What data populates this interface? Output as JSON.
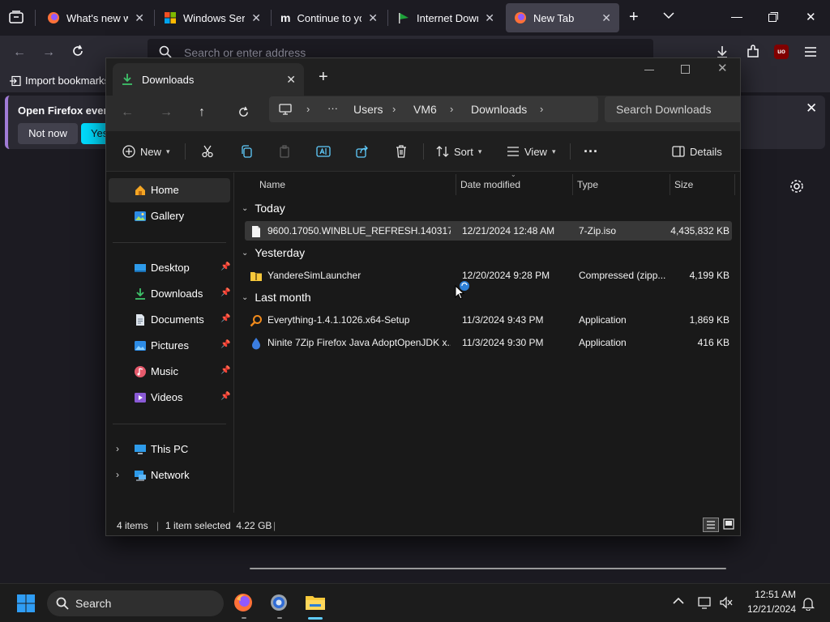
{
  "firefox": {
    "tabs": [
      {
        "title": "What's new wit",
        "icon": "firefox-icon"
      },
      {
        "title": "Windows Server",
        "icon": "windows-logo-icon"
      },
      {
        "title": "Continue to you",
        "icon": "m-logo-icon"
      },
      {
        "title": "Internet Downlo",
        "icon": "idm-logo-icon"
      },
      {
        "title": "New Tab",
        "icon": "firefox-icon",
        "active": true
      }
    ],
    "address_placeholder": "Search or enter address",
    "bookmarks_import": "Import bookmarks",
    "notice": {
      "text": "Open Firefox every",
      "not_now": "Not now",
      "yes": "Yes,"
    }
  },
  "explorer": {
    "tab_title": "Downloads",
    "breadcrumb": [
      "Users",
      "VM6",
      "Downloads"
    ],
    "breadcrumb_more": "···",
    "search_placeholder": "Search Downloads",
    "toolbar": {
      "new": "New",
      "sort": "Sort",
      "view": "View",
      "more": "···",
      "details": "Details"
    },
    "nav": {
      "home": "Home",
      "gallery": "Gallery",
      "quick": [
        "Desktop",
        "Downloads",
        "Documents",
        "Pictures",
        "Music",
        "Videos"
      ],
      "this_pc": "This PC",
      "network": "Network"
    },
    "columns": {
      "name": "Name",
      "date": "Date modified",
      "type": "Type",
      "size": "Size"
    },
    "groups": [
      {
        "label": "Today",
        "files": [
          {
            "name": "9600.17050.WINBLUE_REFRESH.140317-1...",
            "date": "12/21/2024 12:48 AM",
            "type": "7-Zip.iso",
            "size": "4,435,832 KB",
            "icon": "iso-file-icon",
            "selected": true
          }
        ]
      },
      {
        "label": "Yesterday",
        "files": [
          {
            "name": "YandereSimLauncher",
            "date": "12/20/2024 9:28 PM",
            "type": "Compressed (zipp...",
            "size": "4,199 KB",
            "icon": "zip-folder-icon"
          }
        ]
      },
      {
        "label": "Last month",
        "files": [
          {
            "name": "Everything-1.4.1.1026.x64-Setup",
            "date": "11/3/2024 9:43 PM",
            "type": "Application",
            "size": "1,869 KB",
            "icon": "everything-app-icon"
          },
          {
            "name": "Ninite 7Zip Firefox Java AdoptOpenJDK x...",
            "date": "11/3/2024 9:30 PM",
            "type": "Application",
            "size": "416 KB",
            "icon": "ninite-app-icon"
          }
        ]
      }
    ],
    "status": {
      "items": "4 items",
      "selected": "1 item selected  4.22 GB"
    }
  },
  "taskbar": {
    "search": "Search",
    "clock_time": "12:51 AM",
    "clock_date": "12/21/2024"
  },
  "colors": {
    "accent": "#0078d4",
    "firefox_blue": "#00ddff",
    "folder_yellow": "#f8c93b"
  }
}
